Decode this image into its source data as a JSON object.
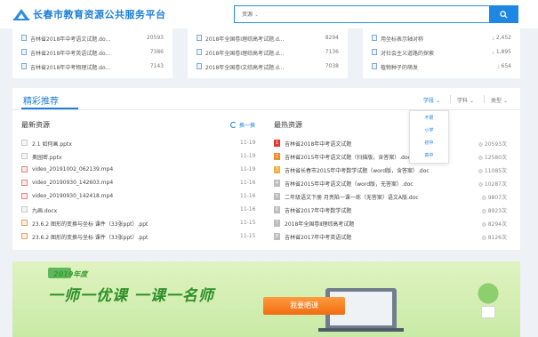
{
  "header": {
    "site_title": "长春市教育资源公共服务平台",
    "search_scope": "资源",
    "search_scope_caret": "⌄",
    "search_placeholder": ""
  },
  "top_cards": [
    {
      "rows": [
        {
          "name": "吉林省2018年中考语文试题.do...",
          "count": "20593"
        },
        {
          "name": "吉林省2018年中考英语试题.do...",
          "count": "7386"
        },
        {
          "name": "吉林省2018年中考物理试题.do...",
          "count": "7143"
        }
      ]
    },
    {
      "rows": [
        {
          "name": "2018年全国卷Ⅰ理综高考试题.d...",
          "count": "8294"
        },
        {
          "name": "2018年全国卷Ⅰ理综高考试题.d...",
          "count": "7136"
        },
        {
          "name": "2018年全国卷Ⅰ文综高考试题.d...",
          "count": "7038"
        }
      ]
    },
    {
      "rows": [
        {
          "name": "用坐标表示轴对称",
          "count": "2,452"
        },
        {
          "name": "对社会主义道路的探索",
          "count": "1,895"
        },
        {
          "name": "植物种子的萌发",
          "count": "654"
        }
      ]
    }
  ],
  "panel": {
    "title": "精彩推荐",
    "filters": [
      {
        "label": "学段",
        "caret": "⌄"
      },
      {
        "label": "学科",
        "caret": "⌄"
      },
      {
        "label": "类型",
        "caret": "⌄"
      }
    ],
    "dropdown_options": [
      "不限",
      "小学",
      "初中",
      "高中"
    ],
    "latest": {
      "title": "最新资源",
      "refresh_label": "换一换",
      "items": [
        {
          "name": "2.1 如何画.pptx",
          "date": "11-19",
          "type": "doc"
        },
        {
          "name": "奥园密.pptx",
          "date": "11-19",
          "type": "doc"
        },
        {
          "name": "video_20191002_062139.mp4",
          "date": "11-19",
          "type": "video"
        },
        {
          "name": "video_20190930_142603.mp4",
          "date": "11-16",
          "type": "video"
        },
        {
          "name": "video_20190930_142418.mp4",
          "date": "11-16",
          "type": "video"
        },
        {
          "name": "九画.docx",
          "date": "11-16",
          "type": "doc"
        },
        {
          "name": "23.6.2 图形的变换与坐标 课件（33张ppt）.ppt",
          "date": "11-15",
          "type": "ppt"
        },
        {
          "name": "23.6.2 图形的变换与坐标 课件（33张ppt）.ppt",
          "date": "11-15",
          "type": "ppt"
        }
      ]
    },
    "hottest": {
      "title": "最热资源",
      "items": [
        {
          "rank": "1",
          "name": "吉林省2018年中考语文试题",
          "count": "20593次"
        },
        {
          "rank": "2",
          "name": "吉林省2015年中考语文试题（扫描版，含答案）.doc",
          "count": "12580次"
        },
        {
          "rank": "3",
          "name": "吉林省长春市2015年中考数学试题（word版，含答案）.doc",
          "count": "11085次"
        },
        {
          "rank": "4",
          "name": "吉林省2015年中考语文试题（word版，无答案）.doc",
          "count": "10287次"
        },
        {
          "rank": "5",
          "name": "二年级语文下册 月亮陷一课一练（无答案）语文A版.doc",
          "count": "9807次"
        },
        {
          "rank": "6",
          "name": "吉林省2017年中考数学试题",
          "count": "8923次"
        },
        {
          "rank": "7",
          "name": "2018年全国卷Ⅱ理综高考试题",
          "count": "8294次"
        },
        {
          "rank": "8",
          "name": "吉林省2017年中考英语试题",
          "count": "8126次"
        }
      ]
    }
  },
  "banner": {
    "year_label": "2019年度",
    "slogan": "一师一优课 一课一名师",
    "cta_label": "我要晒课"
  },
  "colors": {
    "accent": "#1e7fd6",
    "rank_top": "#e53935",
    "rank_mid": "#f28c28",
    "rank_rest": "#bdbdbd",
    "banner_green": "#2f8f2a",
    "cta_orange": "#f07b1d"
  }
}
